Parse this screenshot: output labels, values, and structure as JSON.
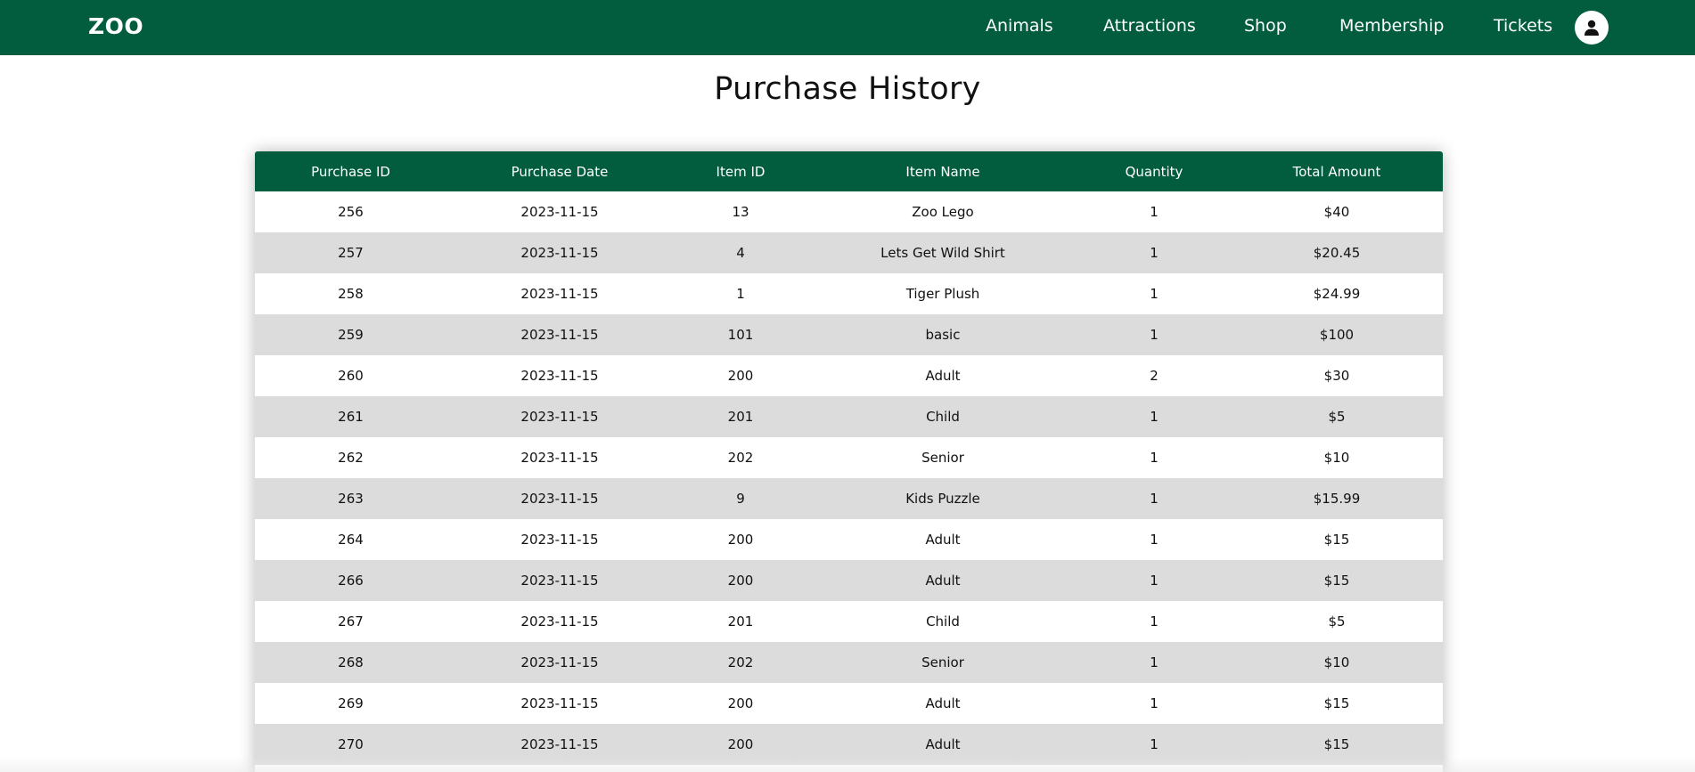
{
  "nav": {
    "logo": "ZOO",
    "links": [
      "Animals",
      "Attractions",
      "Shop",
      "Membership",
      "Tickets"
    ],
    "avatar_icon": "user-icon",
    "brand_color": "#025c3e"
  },
  "page": {
    "title": "Purchase History"
  },
  "table": {
    "headers": [
      "Purchase ID",
      "Purchase Date",
      "Item ID",
      "Item Name",
      "Quantity",
      "Total Amount"
    ],
    "rows": [
      [
        "256",
        "2023-11-15",
        "13",
        "Zoo Lego",
        "1",
        "$40"
      ],
      [
        "257",
        "2023-11-15",
        "4",
        "Lets Get Wild Shirt",
        "1",
        "$20.45"
      ],
      [
        "258",
        "2023-11-15",
        "1",
        "Tiger Plush",
        "1",
        "$24.99"
      ],
      [
        "259",
        "2023-11-15",
        "101",
        "basic",
        "1",
        "$100"
      ],
      [
        "260",
        "2023-11-15",
        "200",
        "Adult",
        "2",
        "$30"
      ],
      [
        "261",
        "2023-11-15",
        "201",
        "Child",
        "1",
        "$5"
      ],
      [
        "262",
        "2023-11-15",
        "202",
        "Senior",
        "1",
        "$10"
      ],
      [
        "263",
        "2023-11-15",
        "9",
        "Kids Puzzle",
        "1",
        "$15.99"
      ],
      [
        "264",
        "2023-11-15",
        "200",
        "Adult",
        "1",
        "$15"
      ],
      [
        "266",
        "2023-11-15",
        "200",
        "Adult",
        "1",
        "$15"
      ],
      [
        "267",
        "2023-11-15",
        "201",
        "Child",
        "1",
        "$5"
      ],
      [
        "268",
        "2023-11-15",
        "202",
        "Senior",
        "1",
        "$10"
      ],
      [
        "269",
        "2023-11-15",
        "200",
        "Adult",
        "1",
        "$15"
      ],
      [
        "270",
        "2023-11-15",
        "200",
        "Adult",
        "1",
        "$15"
      ]
    ]
  }
}
